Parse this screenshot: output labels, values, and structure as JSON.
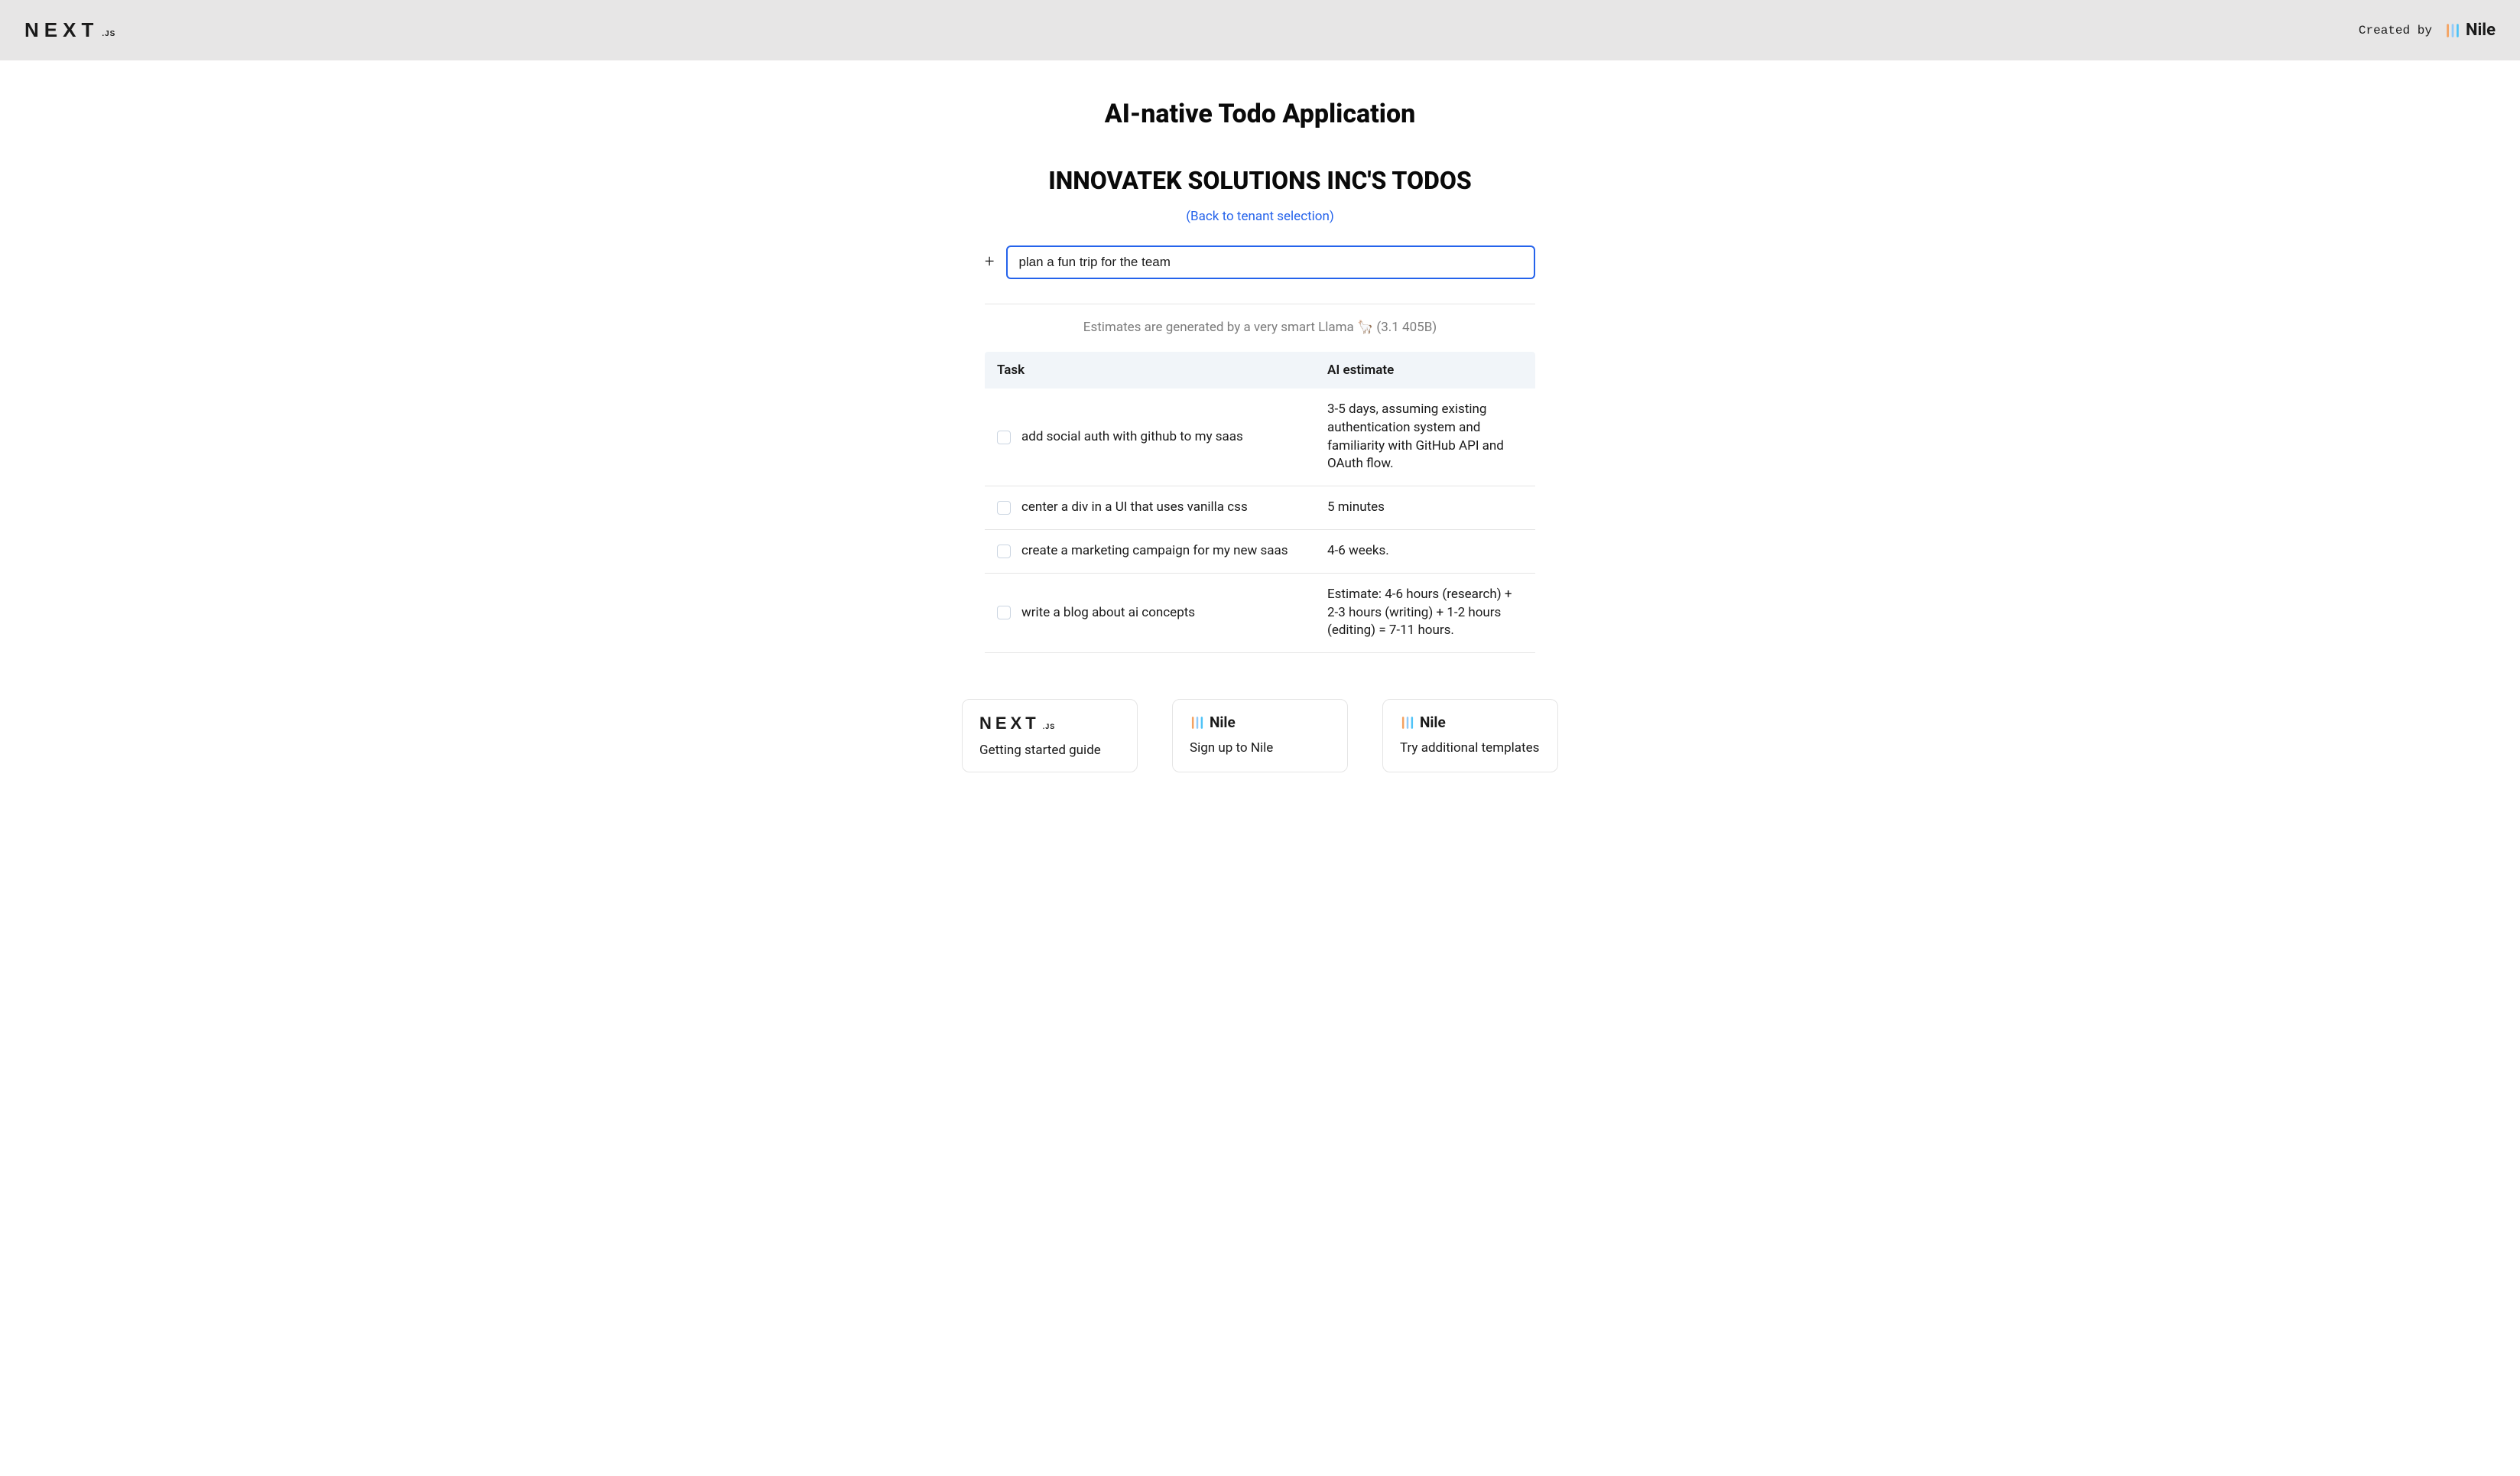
{
  "header": {
    "created_by": "Created by",
    "nextjs_logo": {
      "main": "NEXT",
      "sub": ".JS"
    },
    "nile_logo": {
      "text": "Nile"
    }
  },
  "main": {
    "app_title": "AI-native Todo Application",
    "tenant_title": "INNOVATEK SOLUTIONS INC'S TODOS",
    "back_link": "(Back to tenant selection)",
    "todo_input_value": "plan a fun trip for the team",
    "estimate_note": "Estimates are generated by a very smart Llama 🦙 (3.1 405B)",
    "table": {
      "headers": {
        "task": "Task",
        "estimate": "AI estimate"
      },
      "rows": [
        {
          "task": "add social auth with github to my saas",
          "estimate": "3-5 days, assuming existing authentication system and familiarity with GitHub API and OAuth flow."
        },
        {
          "task": "center a div in a UI that uses vanilla css",
          "estimate": "5 minutes"
        },
        {
          "task": "create a marketing campaign for my new saas",
          "estimate": "4-6 weeks."
        },
        {
          "task": "write a blog about ai concepts",
          "estimate": "Estimate: 4-6 hours (research) + 2-3 hours (writing) + 1-2 hours (editing) = 7-11 hours."
        }
      ]
    }
  },
  "footer": {
    "cards": [
      {
        "logo_type": "nextjs",
        "text": "Getting started guide"
      },
      {
        "logo_type": "nile",
        "text": "Sign up to Nile"
      },
      {
        "logo_type": "nile",
        "text": "Try additional templates"
      }
    ]
  }
}
